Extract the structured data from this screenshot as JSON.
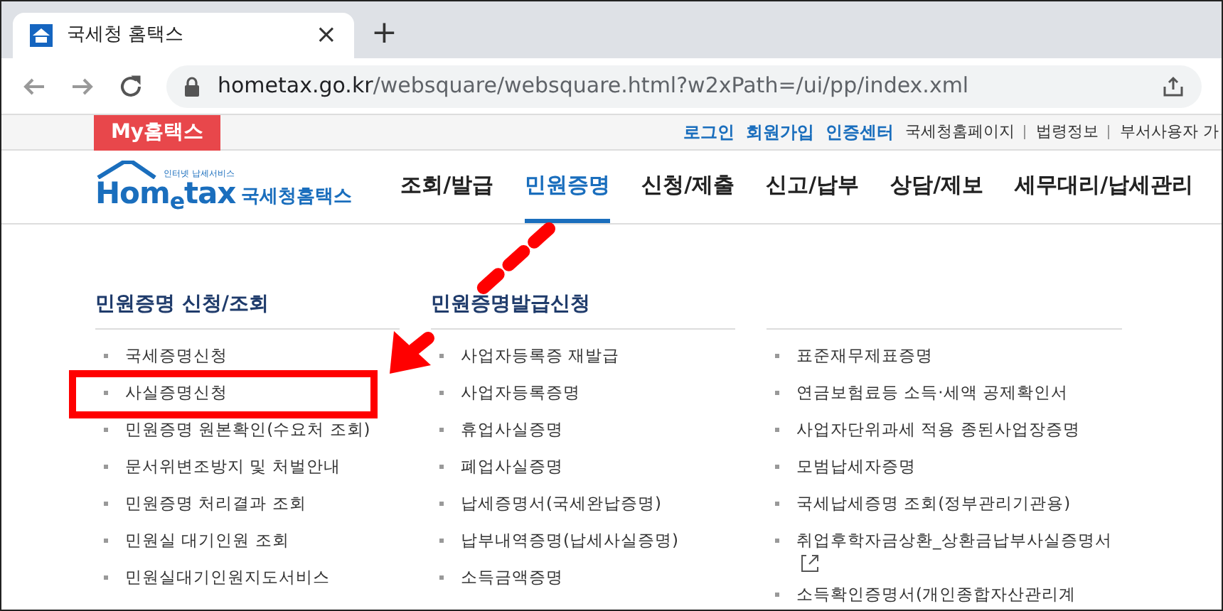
{
  "browser": {
    "tab_title": "국세청 홈택스",
    "close_tab": "×",
    "new_tab": "+",
    "url_host": "hometax.go.kr",
    "url_path": "/websquare/websquare.html?w2xPath=/ui/pp/index.xml"
  },
  "top_bar": {
    "my_tab": "My홈택스",
    "links": [
      {
        "label": "로그인",
        "kind": "primary"
      },
      {
        "label": "회원가입",
        "kind": "primary"
      },
      {
        "label": "인증센터",
        "kind": "primary"
      },
      {
        "label": "국세청홈페이지",
        "kind": "secondary"
      },
      {
        "label": "법령정보",
        "kind": "secondary"
      },
      {
        "label": "부서사용자 가",
        "kind": "secondary"
      }
    ]
  },
  "logo": {
    "tagline": "인터넷 납세서비스",
    "wordmark": "Hom$_{e}$tax",
    "name": "국세청홈택스"
  },
  "nav": [
    {
      "label": "조회/발급",
      "selected": false
    },
    {
      "label": "민원증명",
      "selected": true
    },
    {
      "label": "신청/제출",
      "selected": false
    },
    {
      "label": "신고/납부",
      "selected": false
    },
    {
      "label": "상담/제보",
      "selected": false
    },
    {
      "label": "세무대리/납세관리",
      "selected": false
    }
  ],
  "columns": [
    {
      "heading": "민원증명 신청/조회",
      "items": [
        {
          "label": "국세증명신청",
          "external": false
        },
        {
          "label": "사실증명신청",
          "external": false
        },
        {
          "label": "민원증명 원본확인(수요처 조회)",
          "external": false
        },
        {
          "label": "문서위변조방지 및 처벌안내",
          "external": false
        },
        {
          "label": "민원증명 처리결과 조회",
          "external": false
        },
        {
          "label": "민원실 대기인원 조회",
          "external": false
        },
        {
          "label": "민원실대기인원지도서비스",
          "external": false
        }
      ]
    },
    {
      "heading": "민원증명발급신청",
      "items": [
        {
          "label": "사업자등록증 재발급",
          "external": false
        },
        {
          "label": "사업자등록증명",
          "external": false
        },
        {
          "label": "휴업사실증명",
          "external": false
        },
        {
          "label": "폐업사실증명",
          "external": false
        },
        {
          "label": "납세증명서(국세완납증명)",
          "external": false
        },
        {
          "label": "납부내역증명(납세사실증명)",
          "external": false
        },
        {
          "label": "소득금액증명",
          "external": false
        }
      ]
    },
    {
      "items": [
        {
          "label": "표준재무제표증명",
          "external": false
        },
        {
          "label": "연금보험료등 소득·세액 공제확인서",
          "external": false
        },
        {
          "label": "사업자단위과세 적용 종된사업장증명",
          "external": false
        },
        {
          "label": "모범납세자증명",
          "external": false
        },
        {
          "label": "국세납세증명 조회(정부관리기관용)",
          "external": false
        },
        {
          "label": "취업후학자금상환_상환금납부사실증명서",
          "external": true
        },
        {
          "label": "소득확인증명서(개인종합자산관리계",
          "external": false
        }
      ]
    }
  ]
}
